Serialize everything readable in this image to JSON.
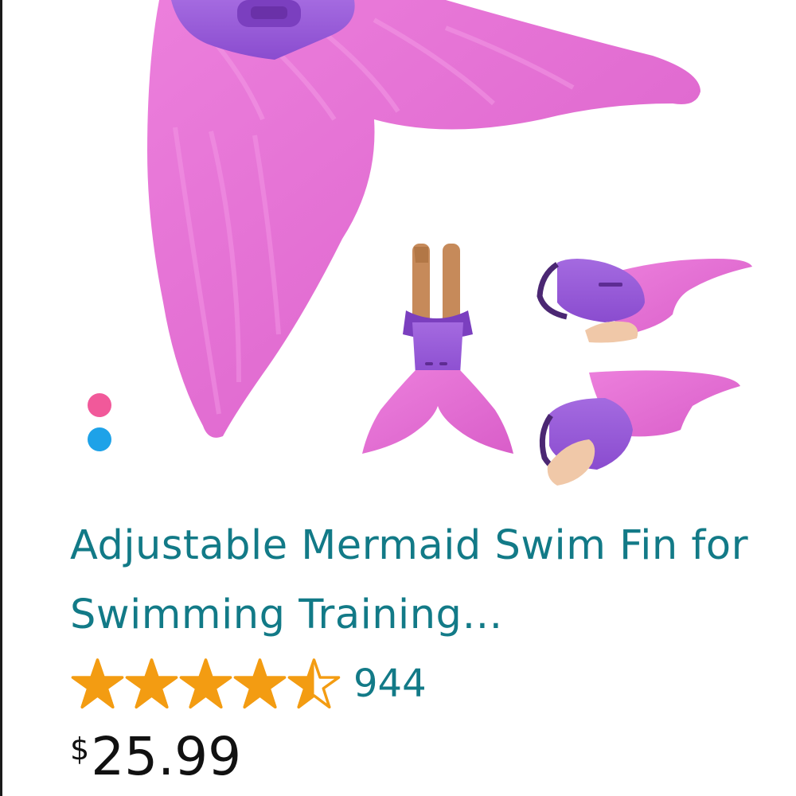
{
  "product": {
    "title": "Adjustable Mermaid Swim Fin for Swimming Training…",
    "rating": 4.5,
    "rating_max": 5,
    "review_count": "944",
    "price_symbol": "$",
    "price_value": "25.99"
  },
  "image": {
    "hero_alt": "mermaid-tail-fin-hero-icon",
    "thumbnails": [
      "fin-worn-front-icon",
      "fin-side-view-icon",
      "fin-strap-view-icon"
    ]
  },
  "swatches": [
    {
      "name": "pink",
      "color": "#f1599a"
    },
    {
      "name": "blue",
      "color": "#1ea2e8"
    }
  ],
  "colors": {
    "link_teal": "#127a87",
    "star_orange": "#f39c12",
    "fin_pink": "#e46bd2",
    "fin_purple": "#9b5fd6"
  }
}
